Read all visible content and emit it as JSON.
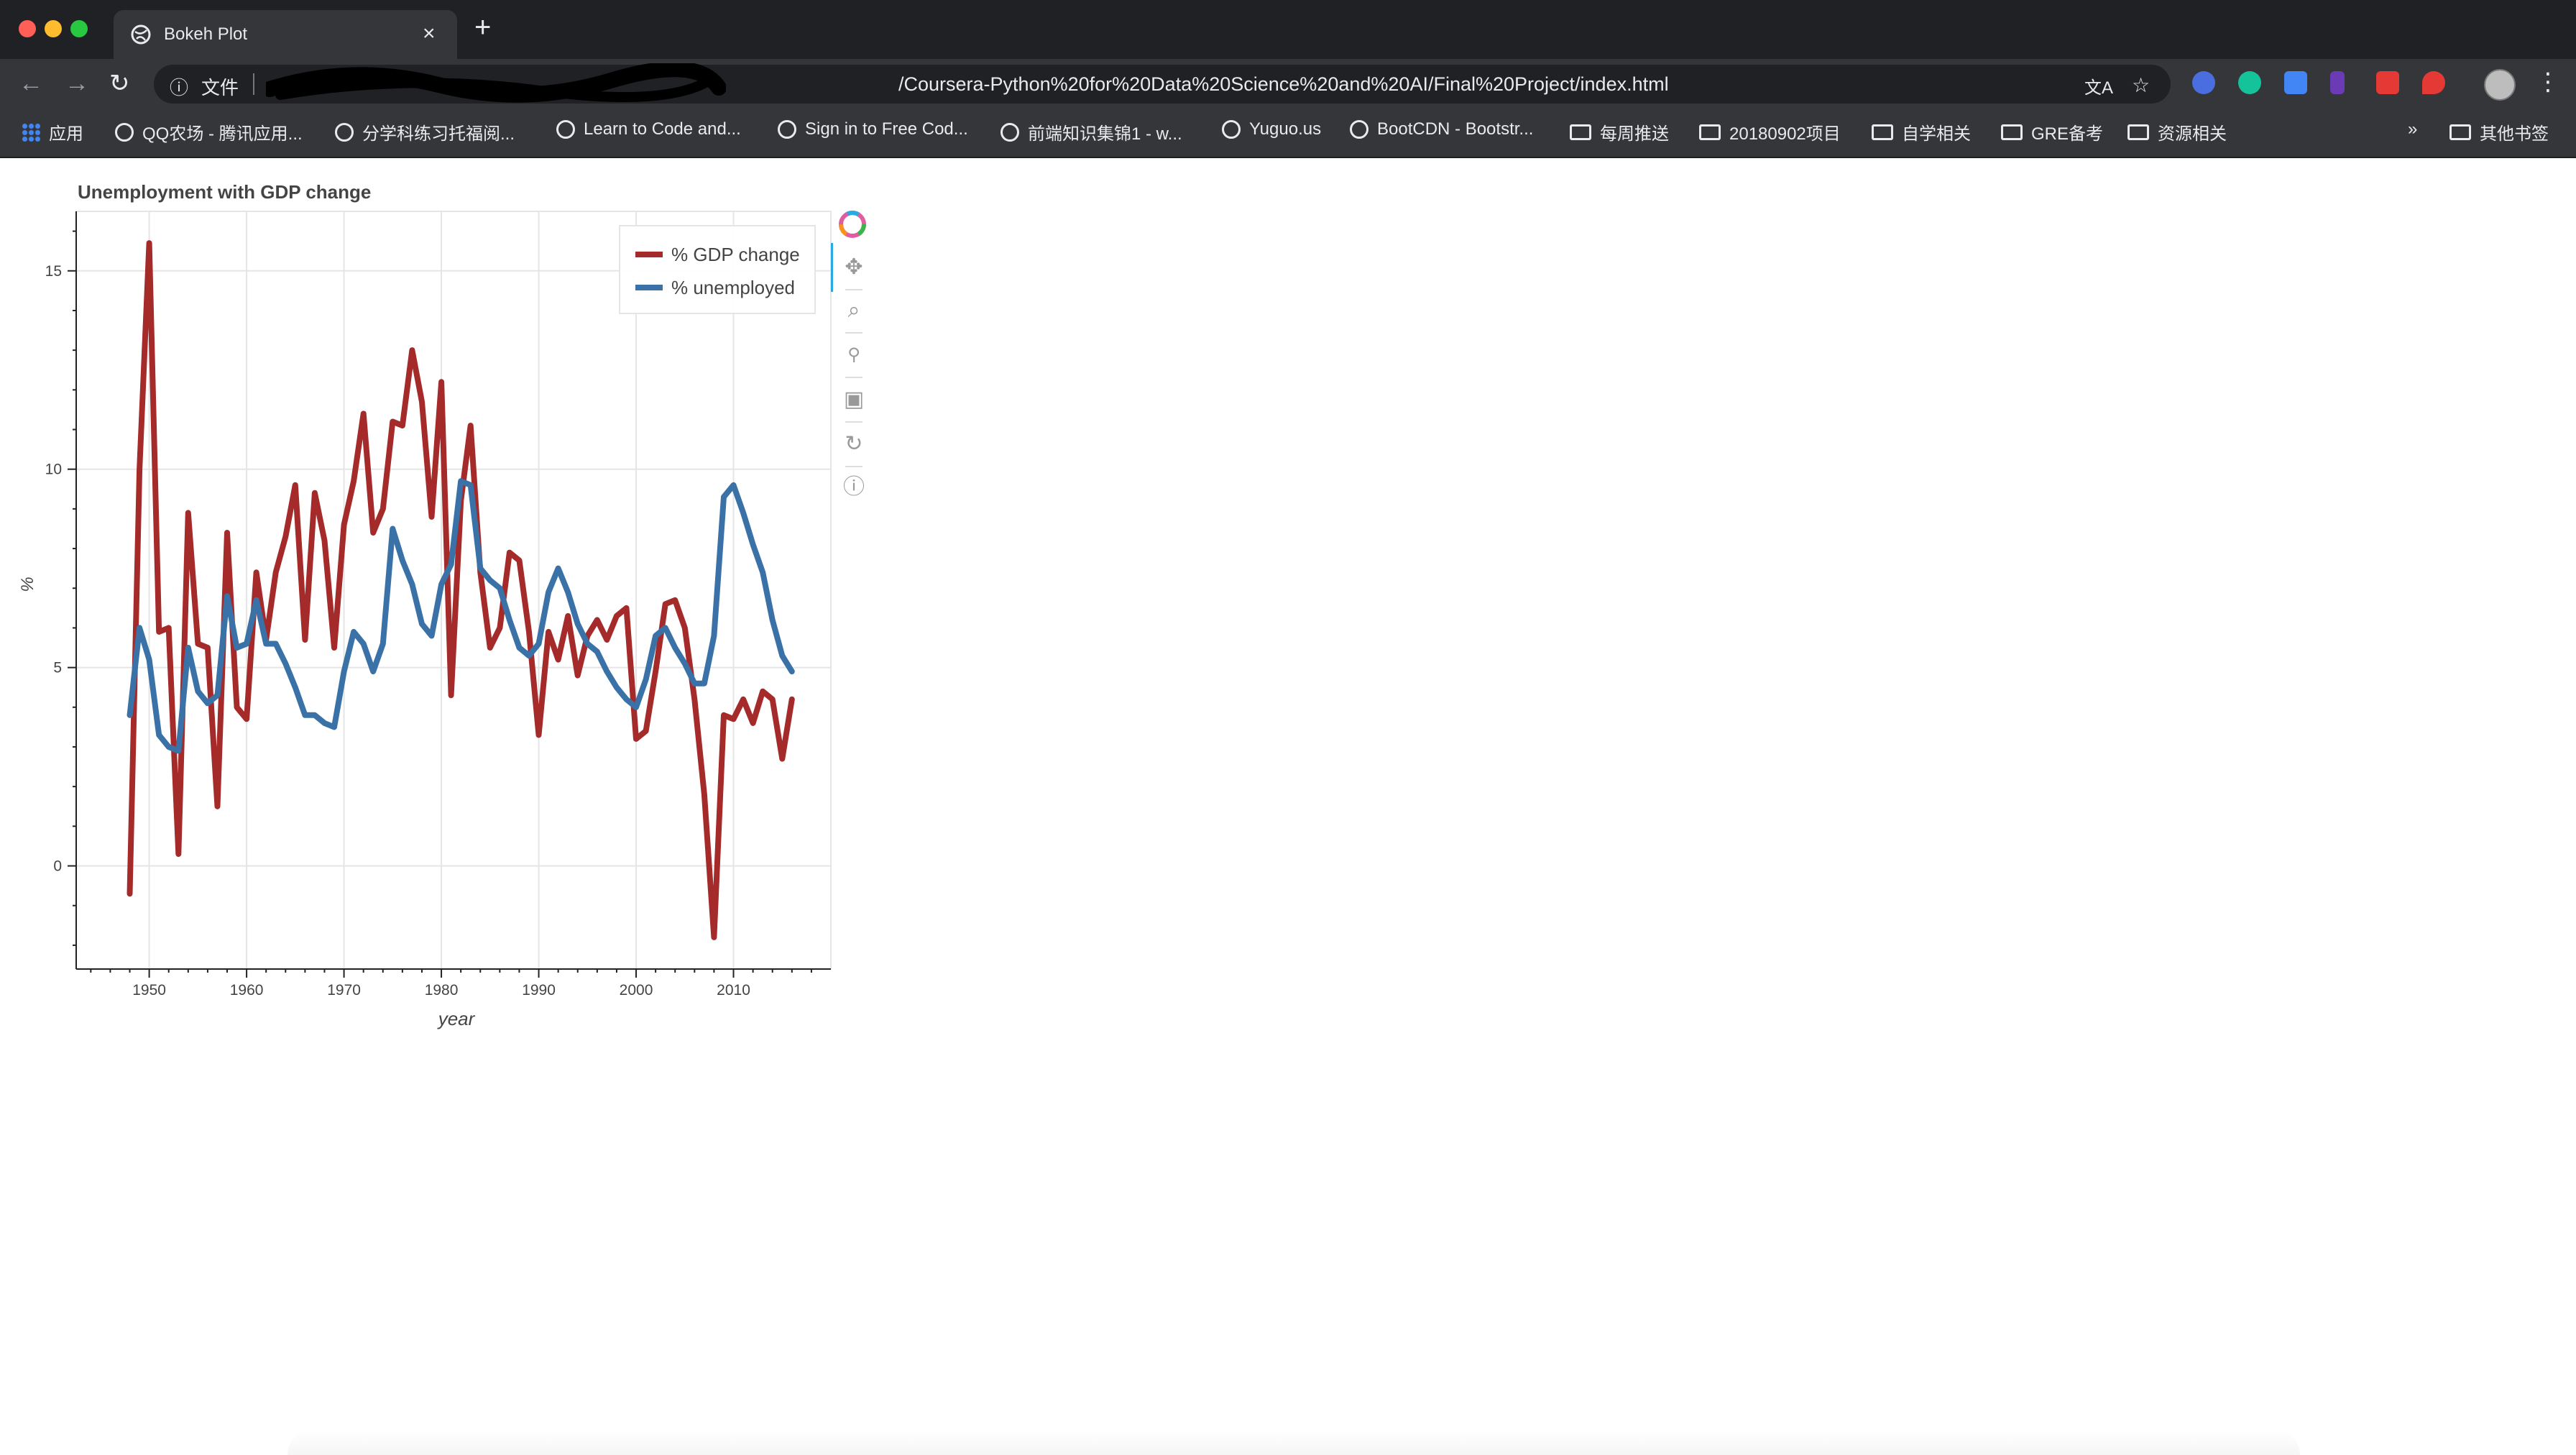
{
  "browser": {
    "tab_title": "Bokeh Plot",
    "omnibox_label": "文件",
    "url": "/Coursera-Python%20for%20Data%20Science%20and%20AI/Final%20Project/index.html",
    "bookmarks": [
      {
        "label": "应用",
        "icon": "apps-grid-icon"
      },
      {
        "label": "QQ农场 - 腾讯应用...",
        "icon": "globe-icon"
      },
      {
        "label": "分学科练习托福阅...",
        "icon": "globe-icon"
      },
      {
        "label": "Learn to Code and...",
        "icon": "globe-icon"
      },
      {
        "label": "Sign in to Free Cod...",
        "icon": "globe-icon"
      },
      {
        "label": "前端知识集锦1 - w...",
        "icon": "globe-icon"
      },
      {
        "label": "Yuguo.us",
        "icon": "globe-icon"
      },
      {
        "label": "BootCDN - Bootstr...",
        "icon": "globe-icon"
      },
      {
        "label": "每周推送",
        "icon": "folder-icon"
      },
      {
        "label": "20180902项目",
        "icon": "folder-icon"
      },
      {
        "label": "自学相关",
        "icon": "folder-icon"
      },
      {
        "label": "GRE备考",
        "icon": "folder-icon"
      },
      {
        "label": "资源相关",
        "icon": "folder-icon"
      }
    ],
    "more_bookmarks": "»",
    "other_bookmarks": "其他书签"
  },
  "chart_data": {
    "type": "line",
    "title": "Unemployment with GDP change",
    "xlabel": "year",
    "ylabel": "%",
    "xlim": [
      1942.5,
      2020
    ],
    "ylim": [
      -2.6,
      16.5
    ],
    "xticks": [
      1950,
      1960,
      1970,
      1980,
      1990,
      2000,
      2010
    ],
    "yticks": [
      0,
      5,
      10,
      15
    ],
    "grid": true,
    "legend_position": "top-right",
    "series": [
      {
        "name": "% GDP change",
        "color": "#a52a2a",
        "x": [
          1948,
          1949,
          1950,
          1951,
          1952,
          1953,
          1954,
          1955,
          1956,
          1957,
          1958,
          1959,
          1960,
          1961,
          1962,
          1963,
          1964,
          1965,
          1966,
          1967,
          1968,
          1969,
          1970,
          1971,
          1972,
          1973,
          1974,
          1975,
          1976,
          1977,
          1978,
          1979,
          1980,
          1981,
          1982,
          1983,
          1984,
          1985,
          1986,
          1987,
          1988,
          1989,
          1990,
          1991,
          1992,
          1993,
          1994,
          1995,
          1996,
          1997,
          1998,
          1999,
          2000,
          2001,
          2002,
          2003,
          2004,
          2005,
          2006,
          2007,
          2008,
          2009,
          2010,
          2011,
          2012,
          2013,
          2014,
          2015,
          2016
        ],
        "values": [
          -0.7,
          10.0,
          15.7,
          5.9,
          6.0,
          0.3,
          8.9,
          5.6,
          5.5,
          1.5,
          8.4,
          4.0,
          3.7,
          7.4,
          5.7,
          7.4,
          8.3,
          9.6,
          5.7,
          9.4,
          8.2,
          5.5,
          8.6,
          9.7,
          11.4,
          8.4,
          9.0,
          11.2,
          11.1,
          13.0,
          11.7,
          8.8,
          12.2,
          4.3,
          9.2,
          11.1,
          7.4,
          5.5,
          6.0,
          7.9,
          7.7,
          5.9,
          3.3,
          5.9,
          5.2,
          6.3,
          4.8,
          5.8,
          6.2,
          5.7,
          6.3,
          6.5,
          3.2,
          3.4,
          4.9,
          6.6,
          6.7,
          6.0,
          4.2,
          1.8,
          -1.8,
          3.8,
          3.7,
          4.2,
          3.6,
          4.4,
          4.2,
          2.7,
          4.2
        ]
      },
      {
        "name": "% unemployed",
        "color": "#3a72a8",
        "x": [
          1948,
          1949,
          1950,
          1951,
          1952,
          1953,
          1954,
          1955,
          1956,
          1957,
          1958,
          1959,
          1960,
          1961,
          1962,
          1963,
          1964,
          1965,
          1966,
          1967,
          1968,
          1969,
          1970,
          1971,
          1972,
          1973,
          1974,
          1975,
          1976,
          1977,
          1978,
          1979,
          1980,
          1981,
          1982,
          1983,
          1984,
          1985,
          1986,
          1987,
          1988,
          1989,
          1990,
          1991,
          1992,
          1993,
          1994,
          1995,
          1996,
          1997,
          1998,
          1999,
          2000,
          2001,
          2002,
          2003,
          2004,
          2005,
          2006,
          2007,
          2008,
          2009,
          2010,
          2011,
          2012,
          2013,
          2014,
          2015,
          2016
        ],
        "values": [
          3.8,
          6.0,
          5.2,
          3.3,
          3.0,
          2.9,
          5.5,
          4.4,
          4.1,
          4.3,
          6.8,
          5.5,
          5.6,
          6.7,
          5.6,
          5.6,
          5.1,
          4.5,
          3.8,
          3.8,
          3.6,
          3.5,
          4.9,
          5.9,
          5.6,
          4.9,
          5.6,
          8.5,
          7.7,
          7.1,
          6.1,
          5.8,
          7.1,
          7.6,
          9.7,
          9.6,
          7.5,
          7.2,
          7.0,
          6.2,
          5.5,
          5.3,
          5.6,
          6.9,
          7.5,
          6.9,
          6.1,
          5.6,
          5.4,
          4.9,
          4.5,
          4.2,
          4.0,
          4.7,
          5.8,
          6.0,
          5.5,
          5.1,
          4.6,
          4.6,
          5.8,
          9.3,
          9.6,
          8.9,
          8.1,
          7.4,
          6.2,
          5.3,
          4.9
        ]
      }
    ]
  }
}
